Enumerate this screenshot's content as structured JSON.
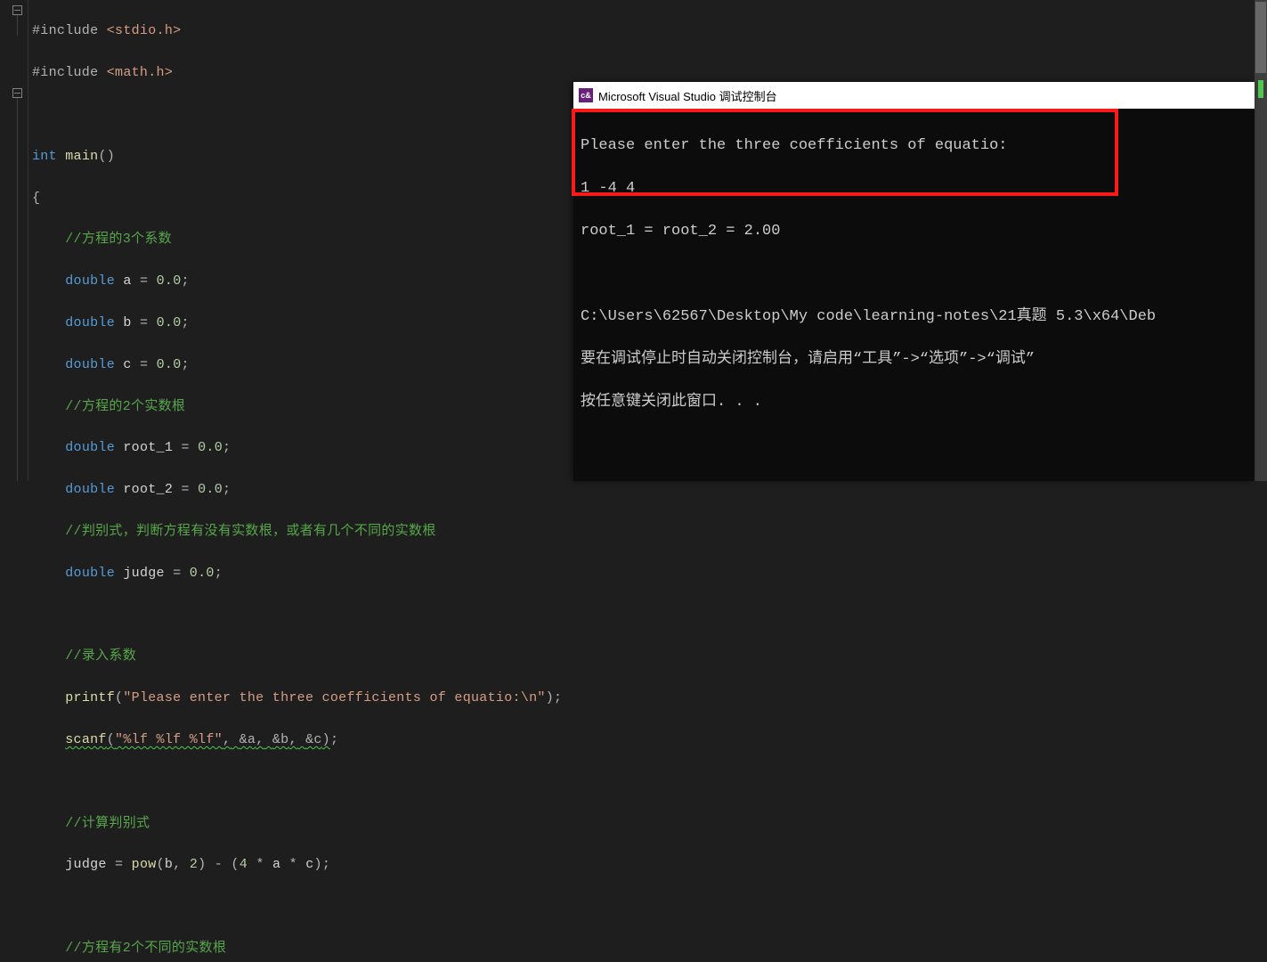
{
  "editor": {
    "line1_pre": "#include ",
    "line1_path": "<stdio.h>",
    "line2_pre": "#include ",
    "line2_path": "<math.h>",
    "kw_int": "int",
    "fn_main": "main",
    "cmt1": "//方程的3个系数",
    "kw_double": "double",
    "id_a": "a",
    "id_b": "b",
    "id_c": "c",
    "zero": "0.0",
    "two_int": "2",
    "four_int": "4",
    "cmt2": "//方程的2个实数根",
    "id_root1": "root_1",
    "id_root2": "root_2",
    "cmt3": "//判别式，判断方程有没有实数根，或者有几个不同的实数根",
    "id_judge": "judge",
    "cmt4": "//录入系数",
    "fn_printf": "printf",
    "str_printf": "\"Please enter the three coefficients of equatio:\\n\"",
    "fn_scanf": "scanf",
    "str_scanf": "\"%lf %lf %lf\"",
    "amp_a": "&a",
    "amp_b": "&b",
    "amp_c": "&c",
    "cmt5": "//计算判别式",
    "fn_pow": "pow",
    "cmt6": "//方程有2个不同的实数根"
  },
  "terminal": {
    "title": "Microsoft Visual Studio 调试控制台",
    "l1": "Please enter the three coefficients of equatio:",
    "l2": "1 -4 4",
    "l3": "root_1 = root_2 = 2.00",
    "l5": "C:\\Users\\62567\\Desktop\\My code\\learning-notes\\21真题 5.3\\x64\\Deb",
    "l6": "要在调试停止时自动关闭控制台，请启用“工具”->“选项”->“调试”",
    "l7": "按任意键关闭此窗口. . ."
  }
}
